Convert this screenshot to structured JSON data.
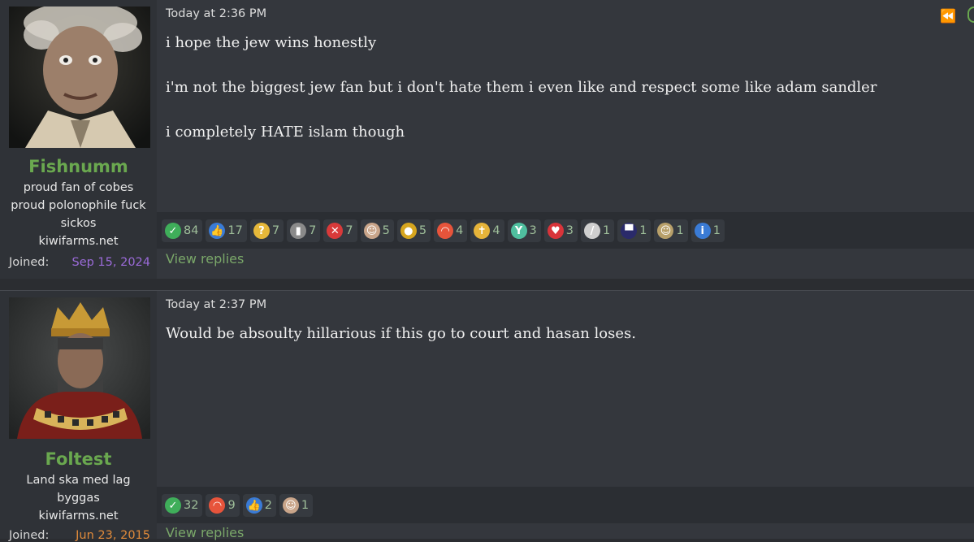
{
  "posts": [
    {
      "timestamp": "Today at 2:36 PM",
      "username": "Fishnumm",
      "user_title": "proud fan of cobes proud polonophile fuck sickos",
      "site": "kiwifarms.net",
      "joined_label": "Joined:",
      "joined_date": "Sep 15, 2024",
      "joined_color": "#9b6bd9",
      "message": [
        "i hope the jew wins honestly",
        "i'm not the biggest jew fan but i don't hate them i even like and respect some like adam sandler",
        "i completely HATE islam though"
      ],
      "reactions": [
        {
          "icon": "checkmark-icon",
          "glyph": "✓",
          "color": "#3fae5a",
          "count": "84"
        },
        {
          "icon": "thumbs-up-icon",
          "glyph": "👍",
          "color": "#3a7bd5",
          "count": "17"
        },
        {
          "icon": "thinking-face-icon",
          "glyph": "?",
          "color": "#e6b83a",
          "count": "7"
        },
        {
          "icon": "tombstone-icon",
          "glyph": "▮",
          "color": "#8a8a8a",
          "count": "7"
        },
        {
          "icon": "x-mark-icon",
          "glyph": "✕",
          "color": "#d93a3a",
          "count": "7"
        },
        {
          "icon": "face-icon",
          "glyph": "☺",
          "color": "#c9a58a",
          "count": "5"
        },
        {
          "icon": "medal-icon",
          "glyph": "●",
          "color": "#d6a51e",
          "count": "5"
        },
        {
          "icon": "rainbow-icon",
          "glyph": "◠",
          "color": "#e7543b",
          "count": "4"
        },
        {
          "icon": "cross-icon",
          "glyph": "✝",
          "color": "#e6b43a",
          "count": "4"
        },
        {
          "icon": "cocktail-icon",
          "glyph": "Y",
          "color": "#4fbf9f",
          "count": "3"
        },
        {
          "icon": "heart-icon",
          "glyph": "♥",
          "color": "#d9343a",
          "count": "3"
        },
        {
          "icon": "bone-icon",
          "glyph": "/",
          "color": "#cfcfcf",
          "count": "1"
        },
        {
          "icon": "top-hat-icon",
          "glyph": "▀",
          "color": "#2a2a6a",
          "count": "1"
        },
        {
          "icon": "soldier-icon",
          "glyph": "☺",
          "color": "#b8a06a",
          "count": "1"
        },
        {
          "icon": "info-icon",
          "glyph": "i",
          "color": "#3a7bd5",
          "count": "1"
        }
      ],
      "view_replies": "View replies"
    },
    {
      "timestamp": "Today at 2:37 PM",
      "username": "Foltest",
      "user_title": "Land ska med lag byggas",
      "site": "kiwifarms.net",
      "joined_label": "Joined:",
      "joined_date": "Jun 23, 2015",
      "joined_color": "#e08a3a",
      "message": [
        "Would be absoulty hillarious if this go to court and hasan loses."
      ],
      "reactions": [
        {
          "icon": "checkmark-icon",
          "glyph": "✓",
          "color": "#3fae5a",
          "count": "32"
        },
        {
          "icon": "rainbow-icon",
          "glyph": "◠",
          "color": "#e7543b",
          "count": "9"
        },
        {
          "icon": "thumbs-up-icon",
          "glyph": "👍",
          "color": "#3a7bd5",
          "count": "2"
        },
        {
          "icon": "face-icon",
          "glyph": "☺",
          "color": "#c9a58a",
          "count": "1"
        }
      ],
      "view_replies": "View replies"
    }
  ]
}
